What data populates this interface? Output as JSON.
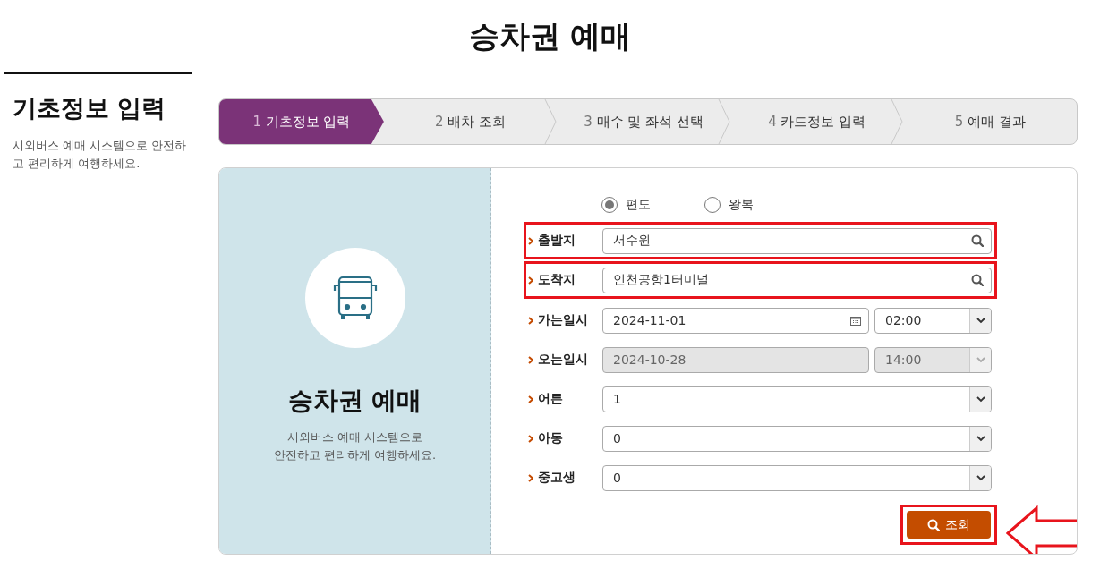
{
  "page_title": "승차권 예매",
  "sidebar": {
    "heading": "기초정보 입력",
    "description": "시외버스 예매 시스템으로 안전하고 편리하게 여행하세요."
  },
  "steps": [
    {
      "number": "1",
      "label": "기초정보 입력",
      "selected": true
    },
    {
      "number": "2",
      "label": "배차 조회",
      "selected": false
    },
    {
      "number": "3",
      "label": "매수 및 좌석 선택",
      "selected": false
    },
    {
      "number": "4",
      "label": "카드정보 입력",
      "selected": false
    },
    {
      "number": "5",
      "label": "예매 결과",
      "selected": false
    }
  ],
  "intro": {
    "title": "승차권 예매",
    "description_lines": [
      "시외버스 예매 시스템으로",
      "안전하고 편리하게 여행하세요."
    ]
  },
  "trip_type": [
    {
      "label": "편도",
      "selected": true
    },
    {
      "label": "왕복",
      "selected": false
    }
  ],
  "fields": [
    {
      "kind": "search",
      "label": "출발지",
      "value": "서수원",
      "highlighted": true
    },
    {
      "kind": "search",
      "label": "도착지",
      "value": "인천공항1터미널",
      "highlighted": true
    },
    {
      "kind": "datetime",
      "label": "가는일시",
      "date": "2024-11-01",
      "time": "02:00",
      "disabled": false
    },
    {
      "kind": "datetime",
      "label": "오는일시",
      "date": "2024-10-28",
      "time": "14:00",
      "disabled": true
    },
    {
      "kind": "select",
      "label": "어른",
      "value": "1"
    },
    {
      "kind": "select",
      "label": "아동",
      "value": "0"
    },
    {
      "kind": "select",
      "label": "중고생",
      "value": "0"
    }
  ],
  "search_button": {
    "label": "조회",
    "highlighted": true
  }
}
